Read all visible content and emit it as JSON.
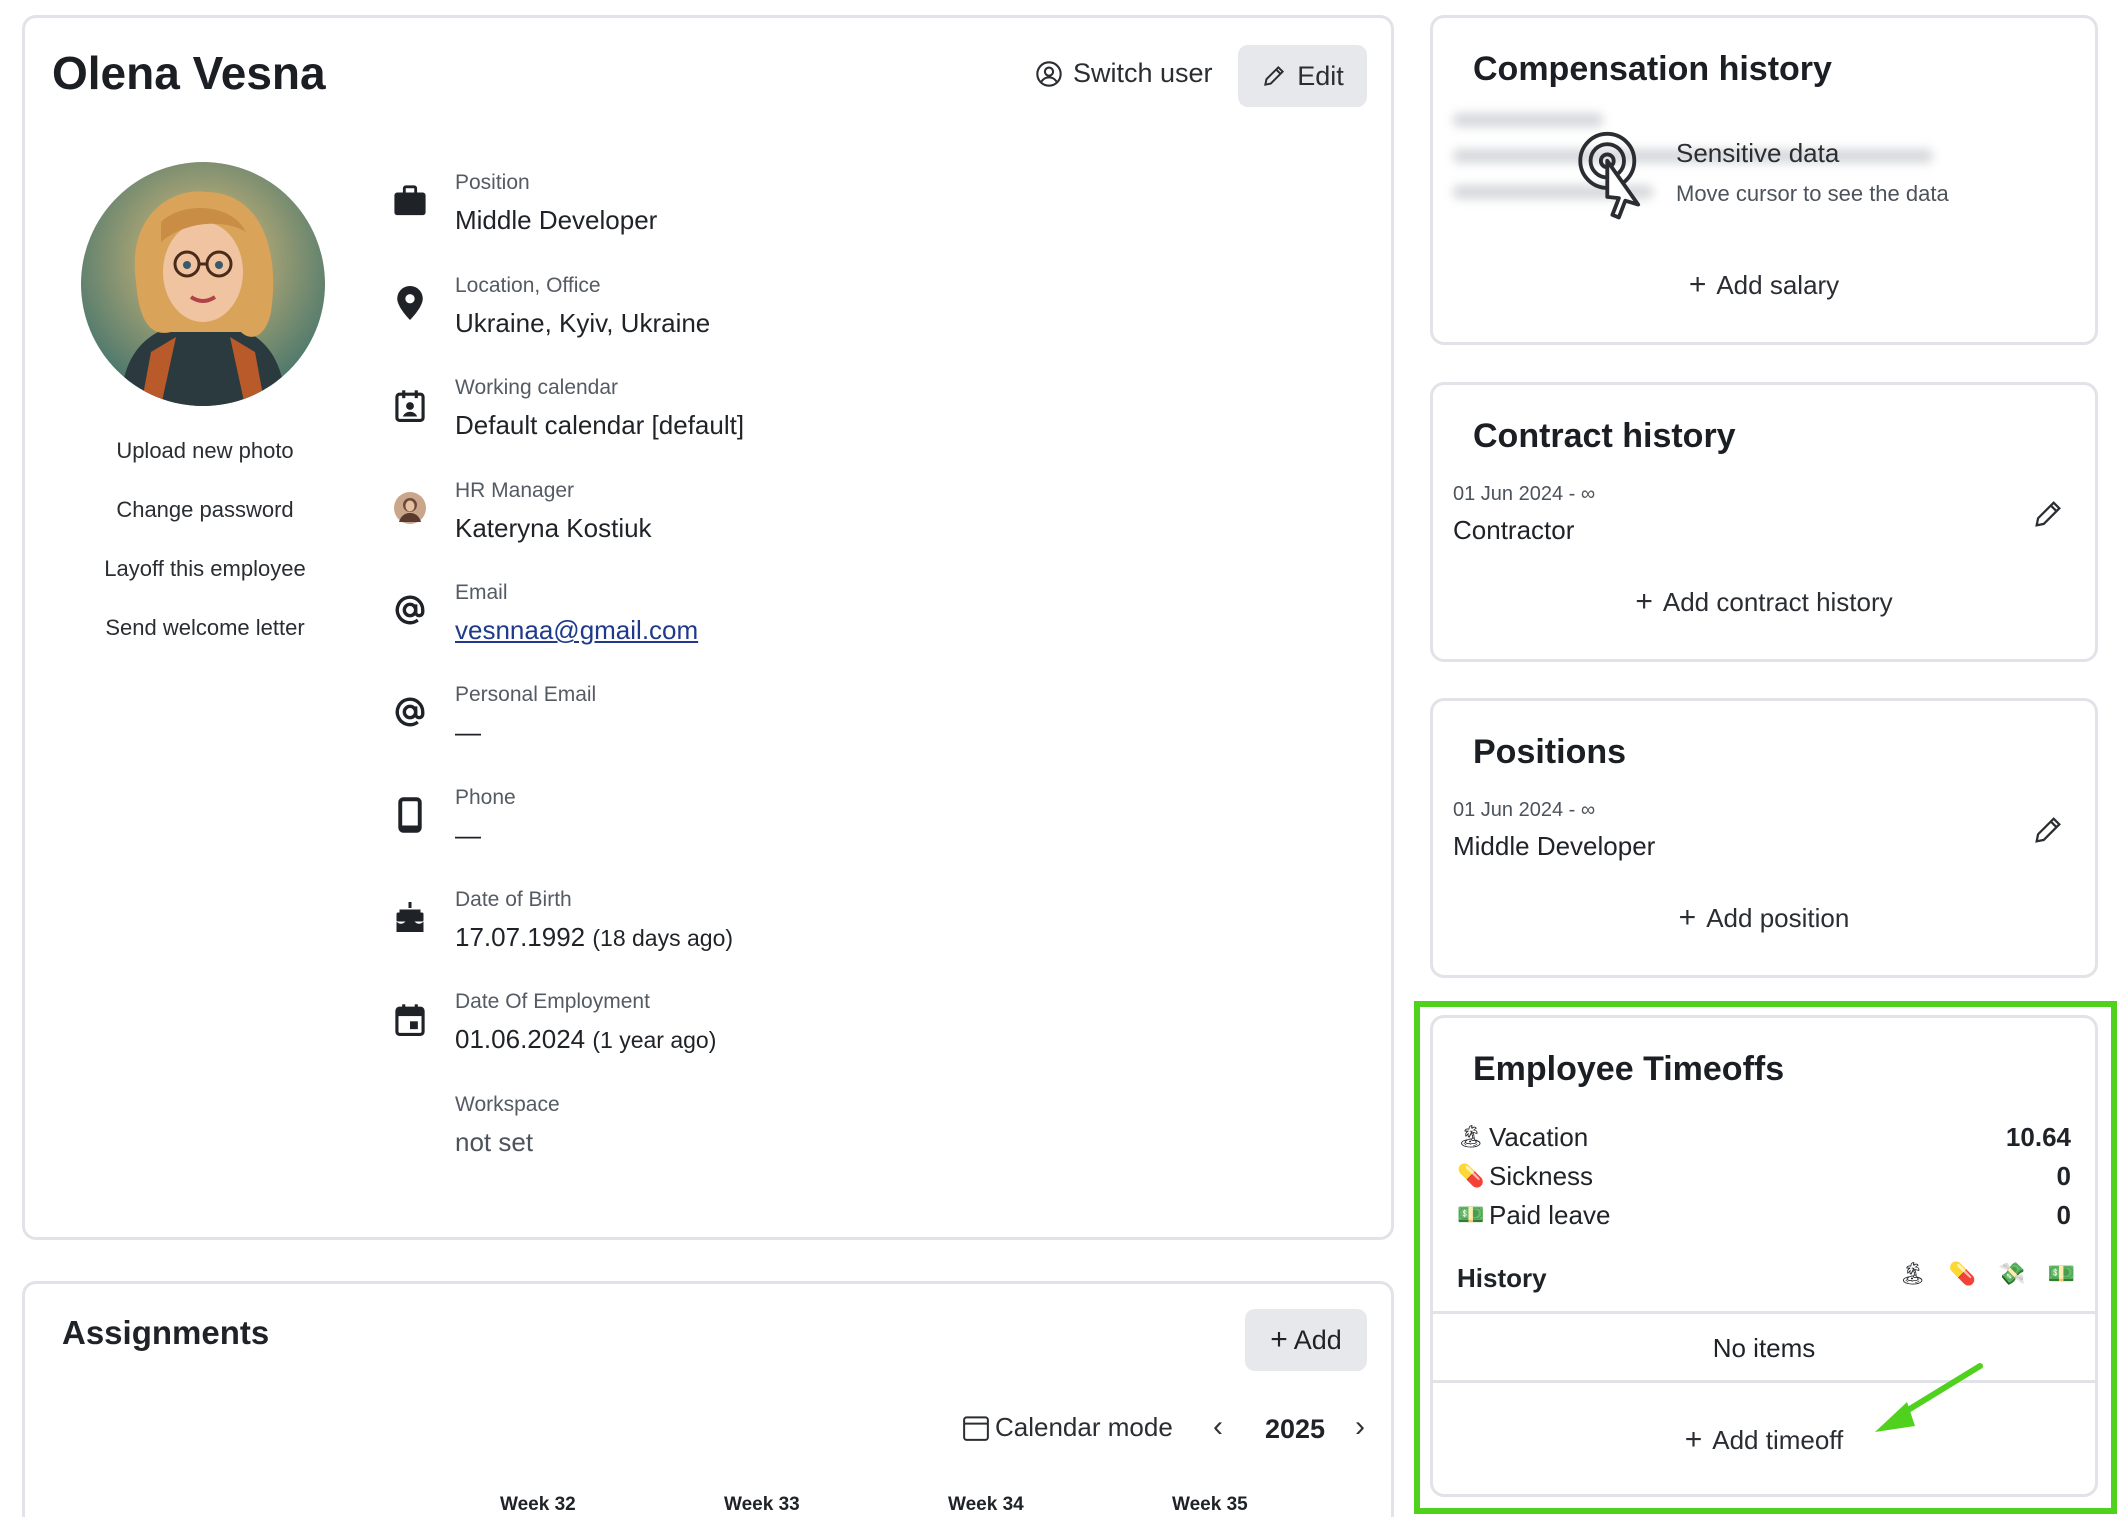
{
  "profile": {
    "name": "Olena Vesna",
    "switch_user_label": "Switch user",
    "edit_label": "Edit",
    "side_links": [
      "Upload new photo",
      "Change password",
      "Layoff this employee",
      "Send welcome letter"
    ],
    "fields": {
      "position": {
        "label": "Position",
        "value": "Middle Developer",
        "icon": "briefcase-icon"
      },
      "location": {
        "label": "Location, Office",
        "value": "Ukraine, Kyiv, Ukraine",
        "icon": "location-pin-icon"
      },
      "calendar": {
        "label": "Working calendar",
        "value": "Default calendar [default]",
        "icon": "calendar-user-icon"
      },
      "hr_manager": {
        "label": "HR Manager",
        "value": "Kateryna Kostiuk",
        "icon": "avatar"
      },
      "email": {
        "label": "Email",
        "value": "vesnnaa@gmail.com",
        "icon": "at-icon"
      },
      "personal_email": {
        "label": "Personal Email",
        "value": "—",
        "icon": "at-icon"
      },
      "phone": {
        "label": "Phone",
        "value": "—",
        "icon": "phone-icon"
      },
      "dob": {
        "label": "Date of Birth",
        "value": "17.07.1992",
        "note": "(18 days ago)",
        "icon": "cake-icon"
      },
      "employment": {
        "label": "Date Of Employment",
        "value": "01.06.2024",
        "note": "(1 year ago)",
        "icon": "calendar-icon"
      },
      "workspace": {
        "label": "Workspace",
        "value": "not set"
      }
    }
  },
  "assignments": {
    "title": "Assignments",
    "add_label": "Add",
    "calendar_mode_label": "Calendar mode",
    "year": "2025",
    "weeks": [
      "Week 32",
      "Week 33",
      "Week 34",
      "Week 35"
    ]
  },
  "compensation": {
    "title": "Compensation history",
    "sensitive_title": "Sensitive data",
    "sensitive_sub": "Move cursor to see the data",
    "add_label": "Add salary"
  },
  "contract": {
    "title": "Contract history",
    "date": "01 Jun 2024 - ∞",
    "value": "Contractor",
    "add_label": "Add contract history"
  },
  "positions": {
    "title": "Positions",
    "date": "01 Jun 2024 - ∞",
    "value": "Middle Developer",
    "add_label": "Add position"
  },
  "timeoffs": {
    "title": "Employee Timeoffs",
    "rows": [
      {
        "emoji": "🏝",
        "name": "Vacation",
        "value": "10.64"
      },
      {
        "emoji": "💊",
        "name": "Sickness",
        "value": "0"
      },
      {
        "emoji": "💵",
        "name": "Paid leave",
        "value": "0"
      }
    ],
    "history_label": "History",
    "history_filter_icons": [
      "🏝",
      "💊",
      "💸",
      "💵"
    ],
    "no_items": "No items",
    "add_label": "Add timeoff"
  },
  "colors": {
    "highlight": "#4fd11e",
    "link": "#1f3a8a"
  }
}
